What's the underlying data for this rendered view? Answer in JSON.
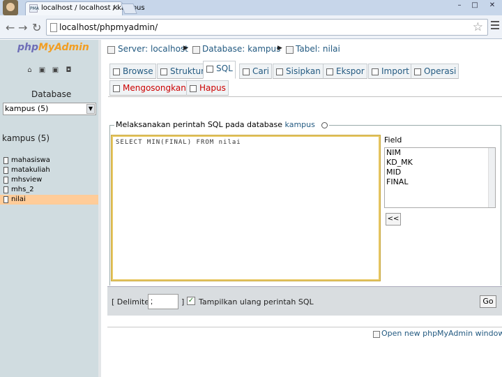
{
  "browser": {
    "tab_title": "localhost / localhost / kampus",
    "favicon_text": "PMA",
    "url": "localhost/phpmyadmin/",
    "window_controls": [
      "–",
      "□",
      "✕"
    ]
  },
  "sidebar": {
    "logo_php": "php",
    "logo_myadmin": "MyAdmin",
    "database_label": "Database",
    "selected_database": "kampus (5)",
    "database_heading": "kampus (5)",
    "tables": [
      "mahasiswa",
      "matakuliah",
      "mhsview",
      "mhs_2",
      "nilai"
    ],
    "active_table": "nilai"
  },
  "breadcrumb": {
    "server": "Server: localhost",
    "database": "Database: kampus",
    "table": "Tabel: nilai"
  },
  "tabs": [
    {
      "label": "Browse",
      "icon": "browse-icon"
    },
    {
      "label": "Struktur",
      "icon": "structure-icon"
    },
    {
      "label": "SQL",
      "icon": "sql-icon",
      "active": true
    },
    {
      "label": "Cari",
      "icon": "search-icon"
    },
    {
      "label": "Sisipkan",
      "icon": "insert-icon"
    },
    {
      "label": "Ekspor",
      "icon": "export-icon"
    },
    {
      "label": "Import",
      "icon": "import-icon"
    },
    {
      "label": "Operasi",
      "icon": "operations-icon"
    },
    {
      "label": "Mengosongkan",
      "icon": "empty-icon"
    },
    {
      "label": "Hapus",
      "icon": "drop-icon"
    }
  ],
  "sql_panel": {
    "legend_text": "Melaksanakan perintah SQL pada database",
    "legend_link": "kampus",
    "query": "SELECT MIN(FINAL) FROM nilai",
    "fields_label": "Field",
    "fields": [
      "NIM",
      "KD_MK",
      "MID",
      "FINAL"
    ],
    "insert_button": "<<"
  },
  "options": {
    "delimiter_label": "[ Delimiter",
    "delimiter_value": ";",
    "delimiter_close": "]",
    "show_query_label": "Tampilkan ulang perintah SQL",
    "show_query_checked": true,
    "go_button": "Go"
  },
  "footer": {
    "new_window_link": "Open new phpMyAdmin window"
  },
  "colors": {
    "sidebar_bg": "#d0dce0",
    "link": "#235a81",
    "active_table_bg": "#ffcc99",
    "danger": "#cc0000"
  }
}
